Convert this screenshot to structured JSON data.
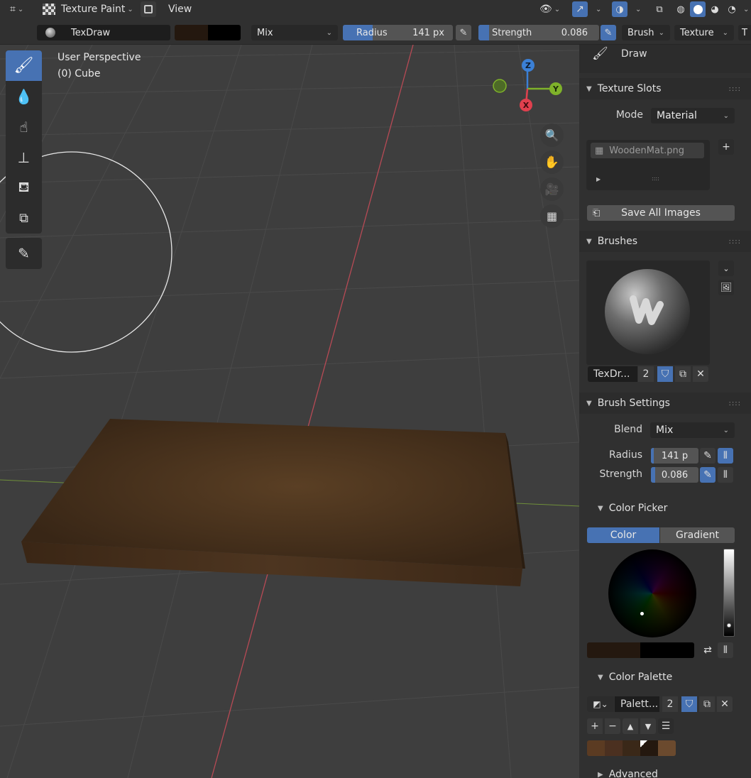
{
  "header": {
    "mode_label": "Texture Paint",
    "view_menu": "View"
  },
  "tool_header": {
    "brush_name": "TexDraw",
    "blend_mode": "Mix",
    "radius_label": "Radius",
    "radius_value": "141 px",
    "radius_fill": 0.27,
    "strength_label": "Strength",
    "strength_value": "0.086",
    "strength_fill": 0.086,
    "brush_menu": "Brush",
    "texture_menu": "Texture",
    "overflow_label": "T",
    "primary_color": "#24180f",
    "secondary_color": "#000000"
  },
  "viewport": {
    "perspective_label": "User Perspective",
    "object_label": "(0) Cube",
    "gizmo": {
      "z": "Z",
      "y": "Y",
      "x": "X"
    }
  },
  "panel": {
    "active_tool_label": "Draw",
    "texture_slots": {
      "title": "Texture Slots",
      "mode_label": "Mode",
      "mode_value": "Material",
      "slot_name": "WoodenMat.png",
      "save_all_button": "Save All Images"
    },
    "brushes": {
      "title": "Brushes",
      "brush_name": "TexDr...",
      "user_count": "2"
    },
    "brush_settings": {
      "title": "Brush Settings",
      "blend_label": "Blend",
      "blend_value": "Mix",
      "radius_label": "Radius",
      "radius_value": "141 p",
      "strength_label": "Strength",
      "strength_value": "0.086"
    },
    "color_picker": {
      "title": "Color Picker",
      "tab_color": "Color",
      "tab_gradient": "Gradient"
    },
    "color_palette": {
      "title": "Color Palette",
      "palette_name": "Palett...",
      "user_count": "2",
      "swatches": [
        "#5b3b22",
        "#4b3020",
        "#3a2818",
        "#24180f",
        "#6b4a2e"
      ]
    },
    "advanced": {
      "title": "Advanced"
    }
  }
}
